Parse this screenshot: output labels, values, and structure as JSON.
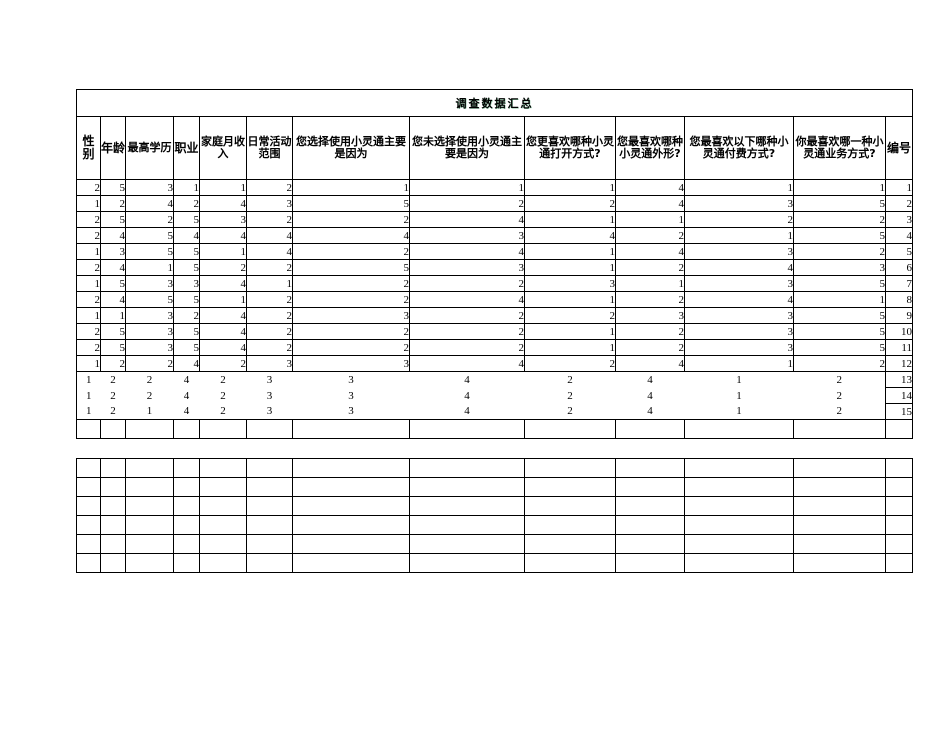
{
  "document": {
    "title": "调查数据汇总"
  },
  "table": {
    "headers": [
      "性别",
      "年龄",
      "最高学历",
      "职业",
      "家庭月收入",
      "日常活动范围",
      "您选择使用小灵通主要是因为",
      "您未选择使用小灵通主要是因为",
      "您更喜欢哪种小灵通打开方式?",
      "您最喜欢哪种小灵通外形?",
      "您最喜欢以下哪种小灵通付费方式?",
      "你最喜欢哪一种小灵通业务方式?",
      "编号"
    ],
    "rows": [
      [
        "2",
        "5",
        "3",
        "1",
        "1",
        "2",
        "1",
        "1",
        "1",
        "4",
        "1",
        "1",
        "1"
      ],
      [
        "1",
        "2",
        "4",
        "2",
        "4",
        "3",
        "5",
        "2",
        "2",
        "4",
        "3",
        "5",
        "2"
      ],
      [
        "2",
        "5",
        "2",
        "5",
        "3",
        "2",
        "2",
        "4",
        "1",
        "1",
        "2",
        "2",
        "3"
      ],
      [
        "2",
        "4",
        "5",
        "4",
        "4",
        "4",
        "4",
        "3",
        "4",
        "2",
        "1",
        "5",
        "4"
      ],
      [
        "1",
        "3",
        "5",
        "5",
        "1",
        "4",
        "2",
        "4",
        "1",
        "4",
        "3",
        "2",
        "5"
      ],
      [
        "2",
        "4",
        "1",
        "5",
        "2",
        "2",
        "5",
        "3",
        "1",
        "2",
        "4",
        "3",
        "6"
      ],
      [
        "1",
        "5",
        "3",
        "3",
        "4",
        "1",
        "2",
        "2",
        "3",
        "1",
        "3",
        "5",
        "7"
      ],
      [
        "2",
        "4",
        "5",
        "5",
        "1",
        "2",
        "2",
        "4",
        "1",
        "2",
        "4",
        "1",
        "8"
      ],
      [
        "1",
        "1",
        "3",
        "2",
        "4",
        "2",
        "3",
        "2",
        "2",
        "3",
        "3",
        "5",
        "9"
      ],
      [
        "2",
        "5",
        "3",
        "5",
        "4",
        "2",
        "2",
        "2",
        "1",
        "2",
        "3",
        "5",
        "10"
      ],
      [
        "2",
        "5",
        "3",
        "5",
        "4",
        "2",
        "2",
        "2",
        "1",
        "2",
        "3",
        "5",
        "11"
      ],
      [
        "1",
        "2",
        "2",
        "4",
        "2",
        "3",
        "3",
        "4",
        "2",
        "4",
        "1",
        "2",
        "12"
      ],
      [
        "1",
        "2",
        "2",
        "4",
        "2",
        "3",
        "3",
        "4",
        "2",
        "4",
        "1",
        "2",
        "13"
      ],
      [
        "1",
        "2",
        "2",
        "4",
        "2",
        "3",
        "3",
        "4",
        "2",
        "4",
        "1",
        "2",
        "14"
      ],
      [
        "1",
        "2",
        "1",
        "4",
        "2",
        "3",
        "3",
        "4",
        "2",
        "4",
        "1",
        "2",
        "15"
      ]
    ],
    "blank_rows_block1": 1,
    "blank_rows_block2": 6
  },
  "colors": {
    "title": "#2E8B57",
    "header_text": "#12787B",
    "border": "#000000",
    "background": "#FFFFFF"
  }
}
